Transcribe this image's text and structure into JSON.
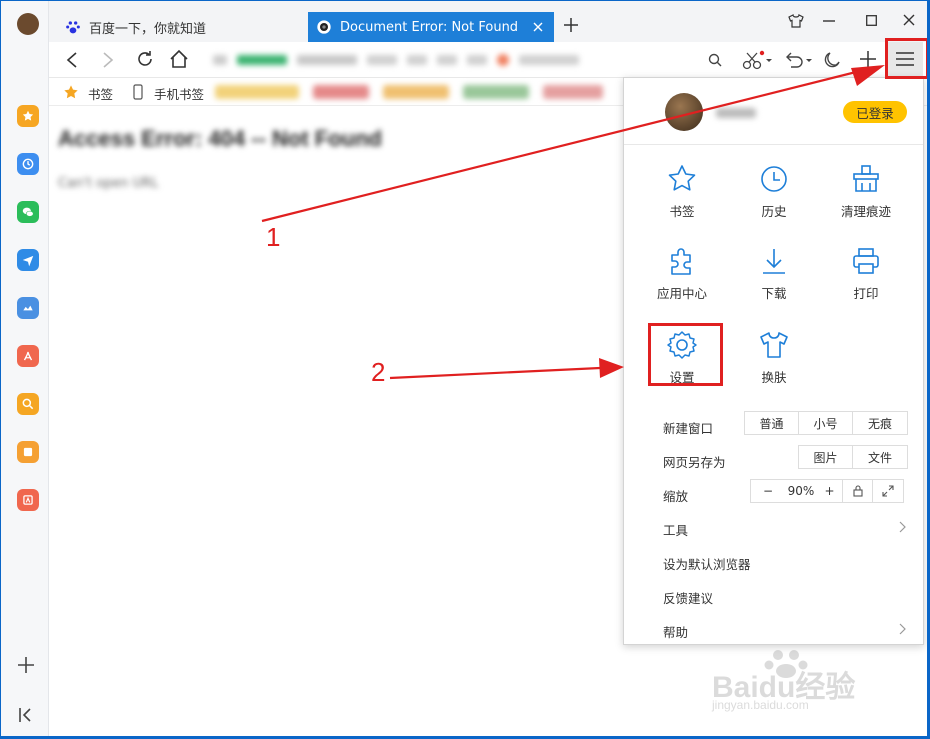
{
  "tabs": [
    {
      "label": "百度一下，你就知道"
    },
    {
      "label": "Document Error: Not Found"
    }
  ],
  "bookmarks_bar": {
    "bookmarks_label": "书签",
    "mobile_label": "手机书签"
  },
  "page": {
    "heading": "Access Error: 404 -- Not Found",
    "subtext": "Can't open URL"
  },
  "menu": {
    "logged_in_badge": "已登录",
    "grid": [
      {
        "label": "书签",
        "icon": "star-icon"
      },
      {
        "label": "历史",
        "icon": "clock-icon"
      },
      {
        "label": "清理痕迹",
        "icon": "broom-icon"
      },
      {
        "label": "应用中心",
        "icon": "puzzle-icon"
      },
      {
        "label": "下载",
        "icon": "download-icon"
      },
      {
        "label": "打印",
        "icon": "printer-icon"
      },
      {
        "label": "设置",
        "icon": "gear-icon"
      },
      {
        "label": "换肤",
        "icon": "shirt-icon"
      }
    ],
    "new_window": {
      "label": "新建窗口",
      "options": [
        "普通",
        "小号",
        "无痕"
      ]
    },
    "save_as": {
      "label": "网页另存为",
      "options": [
        "图片",
        "文件"
      ]
    },
    "zoom": {
      "label": "缩放",
      "minus": "−",
      "value": "90%",
      "plus": "+"
    },
    "tools": "工具",
    "set_default": "设为默认浏览器",
    "feedback": "反馈建议",
    "help": "帮助"
  },
  "annotations": {
    "one": "1",
    "two": "2"
  },
  "watermark": {
    "text": "Baidu经验",
    "url": "jingyan.baidu.com"
  },
  "colors": {
    "accent": "#1e7fd8",
    "badge": "#ffc300",
    "annotation": "#e02020"
  }
}
